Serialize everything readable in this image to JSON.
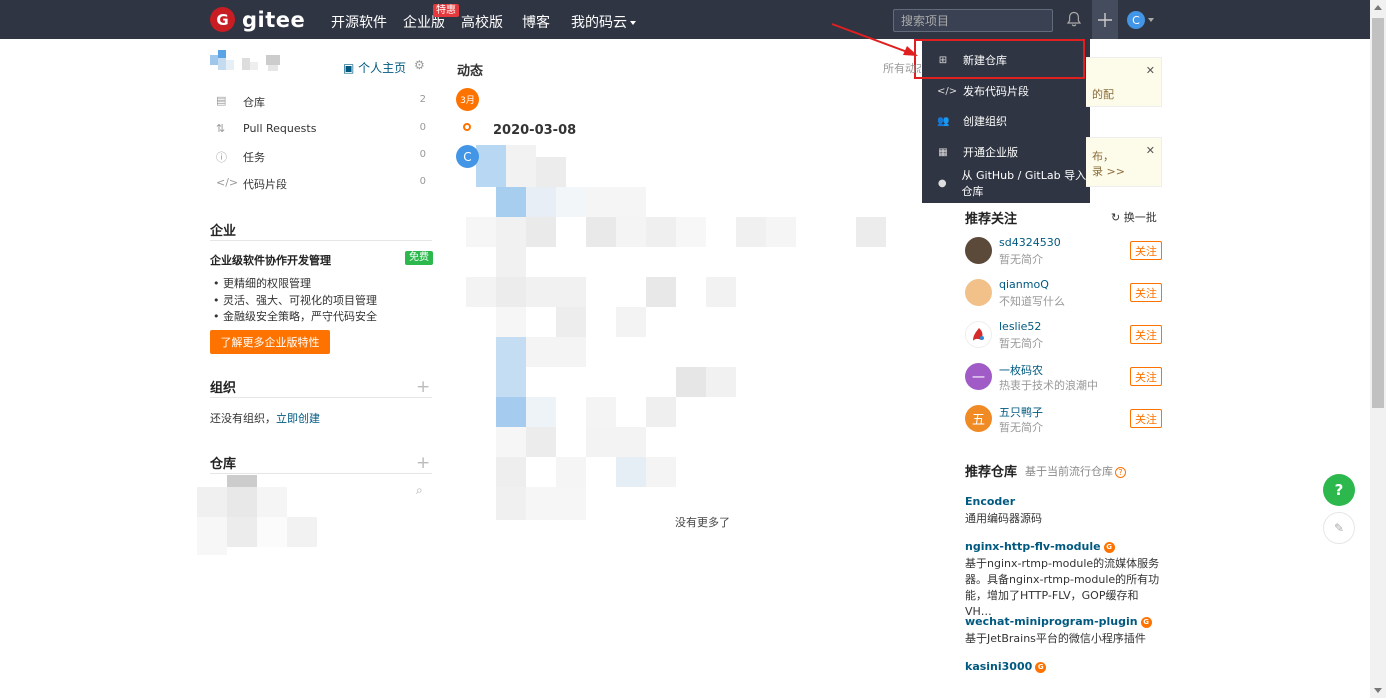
{
  "nav": {
    "logo_mark": "G",
    "logo_text": "gitee",
    "items": [
      "开源软件",
      "企业版",
      "高校版",
      "博客",
      "我的码云"
    ],
    "badge": "特惠",
    "search_placeholder": "搜索项目",
    "avatar_letter": "C"
  },
  "dropdown": {
    "items": [
      {
        "label": "新建仓库",
        "icon": "plus-square-icon"
      },
      {
        "label": "发布代码片段",
        "icon": "code-icon"
      },
      {
        "label": "创建组织",
        "icon": "group-icon"
      },
      {
        "label": "开通企业版",
        "icon": "building-icon"
      },
      {
        "label": "从 GitHub / GitLab 导入仓库",
        "icon": "github-icon"
      }
    ]
  },
  "sidebar": {
    "home_link": "个人主页",
    "items": [
      {
        "label": "仓库",
        "count": "2"
      },
      {
        "label": "Pull Requests",
        "count": "0"
      },
      {
        "label": "任务",
        "count": "0"
      },
      {
        "label": "代码片段",
        "count": "0"
      }
    ],
    "enterprise": {
      "title": "企业",
      "subtitle": "企业级软件协作开发管理",
      "badge": "免费",
      "bullets": [
        "• 更精细的权限管理",
        "• 灵活、强大、可视化的项目管理",
        "• 金融级安全策略，严守代码安全"
      ],
      "button": "了解更多企业版特性"
    },
    "org": {
      "title": "组织",
      "empty_text": "还没有组织，",
      "create_link": "立即创建"
    },
    "repo": {
      "title": "仓库"
    }
  },
  "feed": {
    "title": "动态",
    "filter": "所有动态",
    "month": "3月",
    "date": "2020-03-08",
    "avatar_letter": "C",
    "no_more": "没有更多了"
  },
  "notices": [
    {
      "line1": "的配",
      "line2": ""
    },
    {
      "line1": "布，",
      "line2": "录 >>"
    }
  ],
  "recommend_users": {
    "title": "推荐关注",
    "refresh": "换一批",
    "follow_label": "关注",
    "users": [
      {
        "name": "sd4324530",
        "desc": "暂无简介",
        "avatar": "",
        "color": "#5b4a3a"
      },
      {
        "name": "qianmoQ",
        "desc": "不知道写什么",
        "avatar": "",
        "color": "#f2c18a"
      },
      {
        "name": "leslie52",
        "desc": "暂无简介",
        "avatar": "",
        "color": "#ffffff"
      },
      {
        "name": "一枚码农",
        "desc": "热衷于技术的浪潮中",
        "avatar": "一",
        "color": "#a05bc7"
      },
      {
        "name": "五只鸭子",
        "desc": "暂无简介",
        "avatar": "五",
        "color": "#f08a24"
      }
    ]
  },
  "recommend_repos": {
    "title": "推荐仓库",
    "subtitle": "基于当前流行仓库",
    "repos": [
      {
        "name": "Encoder",
        "desc": "通用编码器源码",
        "gvp": false
      },
      {
        "name": "nginx-http-flv-module",
        "desc": "基于nginx-rtmp-module的流媒体服务器。具备nginx-rtmp-module的所有功能，增加了HTTP-FLV，GOP缓存和VH…",
        "gvp": true
      },
      {
        "name": "wechat-miniprogram-plugin",
        "desc": "基于JetBrains平台的微信小程序插件",
        "gvp": true
      },
      {
        "name": "kasini3000",
        "desc": "",
        "gvp": true
      }
    ]
  },
  "float": {
    "help": "?"
  },
  "colors": {
    "nav_bg": "#2f3542",
    "accent": "#fe7300",
    "link": "#005980",
    "green": "#2db84d",
    "highlight": "#e02020"
  }
}
